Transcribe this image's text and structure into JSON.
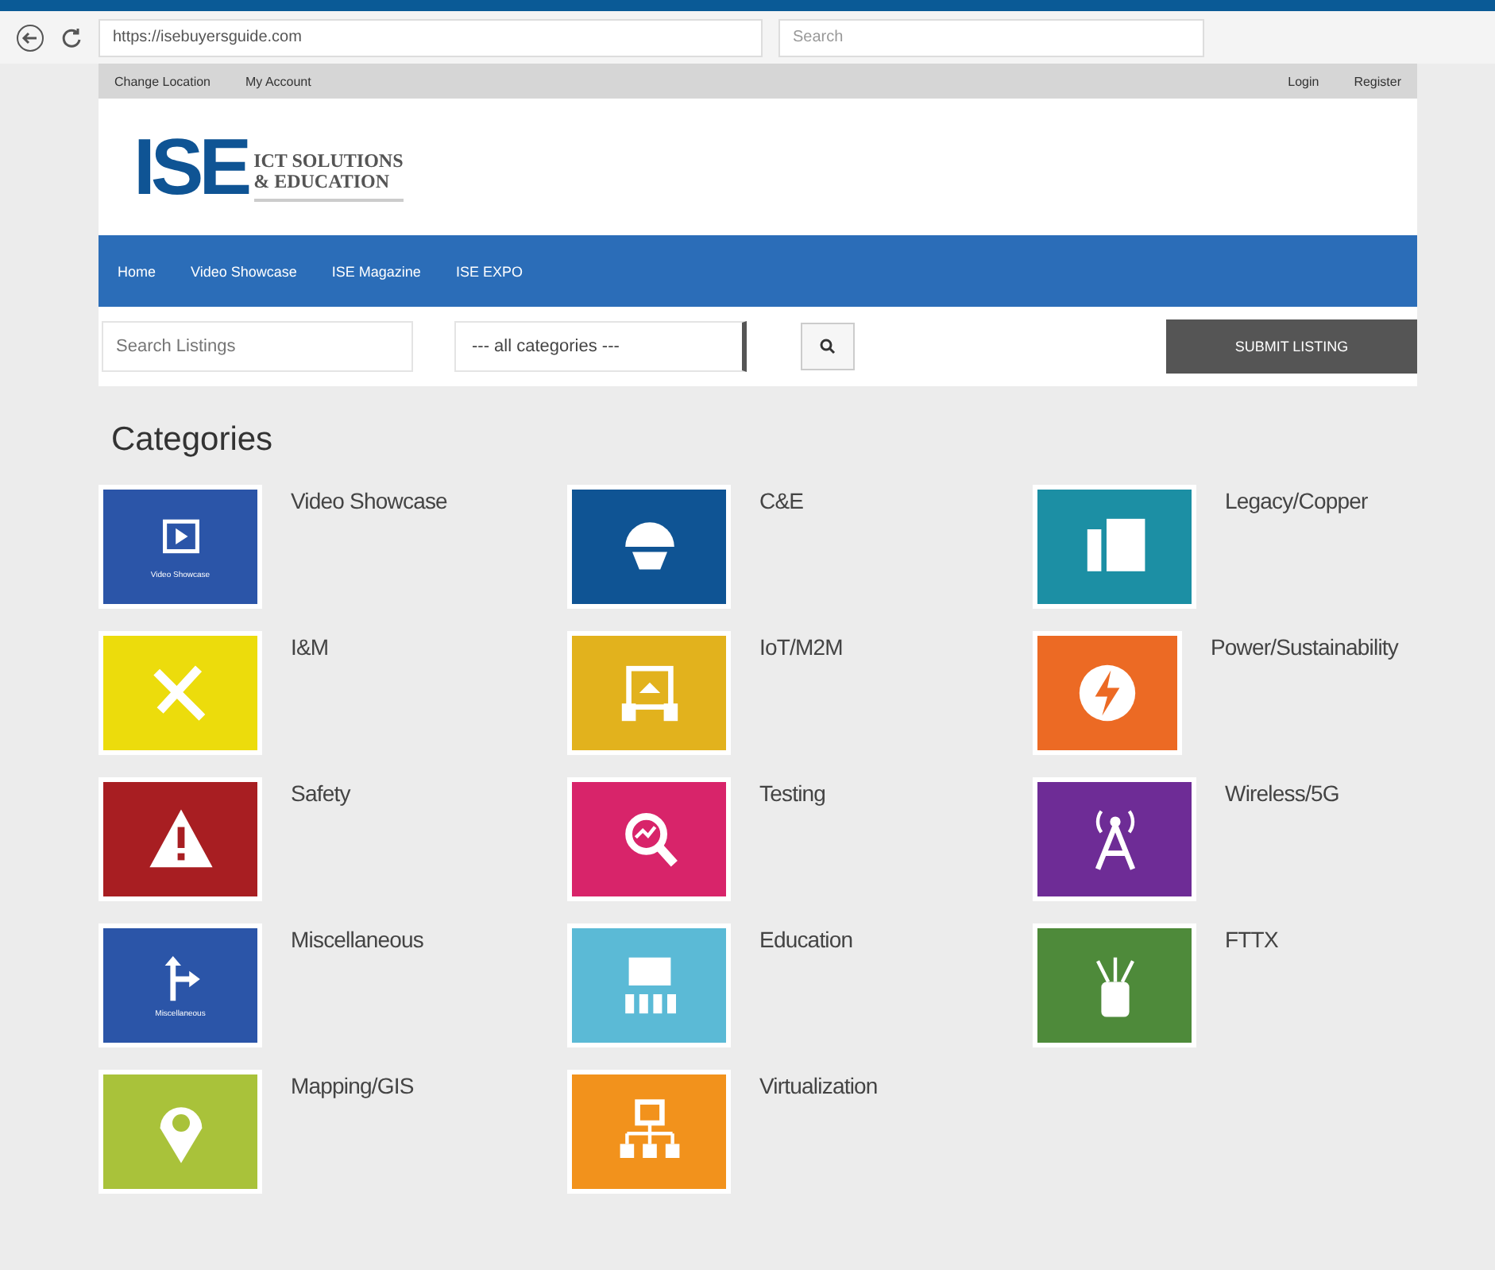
{
  "browser": {
    "url": "https://isebuyersguide.com",
    "search_placeholder": "Search"
  },
  "top_bar": {
    "left_links": [
      "Change Location",
      "My Account"
    ],
    "right_links": [
      "Login",
      "Register"
    ]
  },
  "logo": {
    "mark": "ISE",
    "lines": [
      "ICT SOLUTIONS",
      "& EDUCATION"
    ]
  },
  "nav": [
    "Home",
    "Video Showcase",
    "ISE Magazine",
    "ISE EXPO"
  ],
  "search": {
    "placeholder": "Search Listings",
    "category": "--- all categories ---",
    "submit": "SUBMIT LISTING"
  },
  "categories": {
    "title": "Categories",
    "items": [
      {
        "label": "Video Showcase",
        "color": "#2b55a8",
        "caption": "Video Showcase"
      },
      {
        "label": "C&E",
        "color": "#0f5494"
      },
      {
        "label": "Legacy/Copper",
        "color": "#1c8fa4"
      },
      {
        "label": "I&M",
        "color": "#ecdc0c"
      },
      {
        "label": "IoT/M2M",
        "color": "#e2b21d"
      },
      {
        "label": "Power/Sustainability",
        "color": "#ec6a24"
      },
      {
        "label": "Safety",
        "color": "#a81e22"
      },
      {
        "label": "Testing",
        "color": "#d8246a"
      },
      {
        "label": "Wireless/5G",
        "color": "#6e2c96"
      },
      {
        "label": "Miscellaneous",
        "color": "#2b55a8",
        "caption": "Miscellaneous"
      },
      {
        "label": "Education",
        "color": "#5bbad6"
      },
      {
        "label": "FTTX",
        "color": "#4e8a3a"
      },
      {
        "label": "Mapping/GIS",
        "color": "#a9c23a"
      },
      {
        "label": "Virtualization",
        "color": "#f2921c"
      }
    ]
  }
}
